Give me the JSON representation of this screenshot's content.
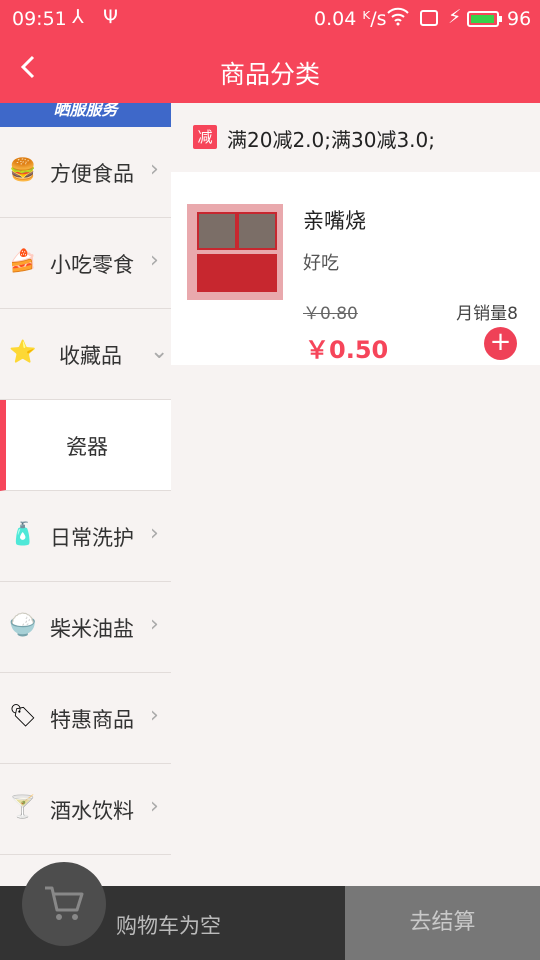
{
  "status": {
    "time": "09:51",
    "speed": "0.04 ᴷ/s",
    "battery": "96",
    "battery_level": 0.96
  },
  "header": {
    "back_icon": "chevron-left-icon",
    "title": "商品分类"
  },
  "sidebar": {
    "banner_text": "晒服服务",
    "items": [
      {
        "label": "方便食品",
        "icon": "burger-icon"
      },
      {
        "label": "小吃零食",
        "icon": "cake-icon"
      },
      {
        "label": "收藏品",
        "icon": "star-icon"
      },
      {
        "label": "瓷器",
        "icon": ""
      },
      {
        "label": "日常洗护",
        "icon": "bottle-icon"
      },
      {
        "label": "柴米油盐",
        "icon": "rice-bowl-icon"
      },
      {
        "label": "特惠商品",
        "icon": "price-tag-icon"
      },
      {
        "label": "酒水饮料",
        "icon": "cocktail-icon"
      }
    ]
  },
  "promo": {
    "tag": "减",
    "text": "满20减2.0;满30减3.0;"
  },
  "products": [
    {
      "name": "亲嘴烧",
      "desc": "好吃",
      "old_price": "￥0.80",
      "sales": "月销量8",
      "price": "￥0.50",
      "add_label": "+"
    }
  ],
  "cart": {
    "empty_text": "购物车为空",
    "checkout_label": "去结算"
  },
  "colors": {
    "accent": "#f6455a",
    "cart_bar": "#333333",
    "checkout_bar": "#777777"
  }
}
